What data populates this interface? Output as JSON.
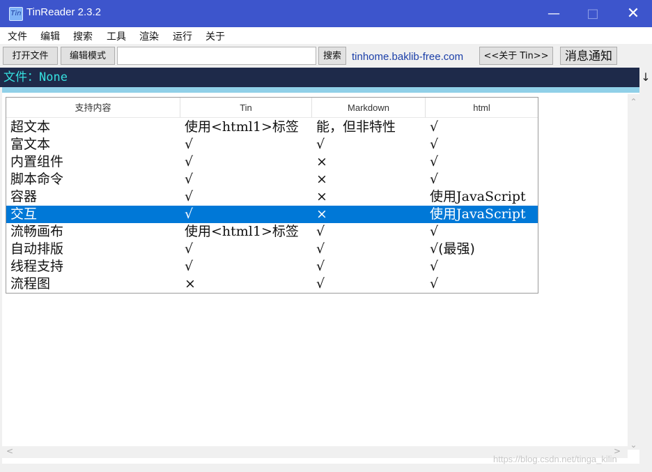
{
  "window": {
    "title": "TinReader 2.3.2",
    "app_icon": "Tin",
    "minimize": "—",
    "maximize": "□",
    "close": "✕"
  },
  "menu": [
    "文件",
    "编辑",
    "搜索",
    "工具",
    "渲染",
    "运行",
    "关于"
  ],
  "toolbar": {
    "open_file": "打开文件",
    "edit_mode": "编辑模式",
    "search_value": "",
    "search_button": "搜索",
    "link": "tinhome.baklib-free.com",
    "about": "<<关于 Tin>>",
    "notify": "消息通知"
  },
  "file_bar": {
    "text": "文件：None"
  },
  "scroll": {
    "down_arrow": "↓",
    "up": "⌃",
    "down": "⌄",
    "left": "<",
    "right": ">"
  },
  "table": {
    "headers": [
      "支持内容",
      "Tin",
      "Markdown",
      "html"
    ],
    "rows": [
      [
        "超文本",
        "使用<html1>标签",
        "能，但非特性",
        "√"
      ],
      [
        "富文本",
        "√",
        "√",
        "√"
      ],
      [
        "内置组件",
        "√",
        "×",
        "√"
      ],
      [
        "脚本命令",
        "√",
        "×",
        "√"
      ],
      [
        "容器",
        "√",
        "×",
        "使用JavaScript"
      ],
      [
        "交互",
        "√",
        "×",
        "使用JavaScript"
      ],
      [
        "流畅画布",
        "使用<html1>标签",
        "√",
        "√"
      ],
      [
        "自动排版",
        "√",
        "√",
        "√(最强)"
      ],
      [
        "线程支持",
        "√",
        "√",
        "√"
      ],
      [
        "流程图",
        "×",
        "√",
        "√"
      ]
    ],
    "selected_row": 5
  },
  "watermark": "https://blog.csdn.net/tinga_kilin",
  "colors": {
    "titlebar": "#3d55cc",
    "file_bar": "#1e2a4a",
    "file_text": "#36e0e0",
    "selection": "#0078d7",
    "link": "#1a3ea8"
  }
}
